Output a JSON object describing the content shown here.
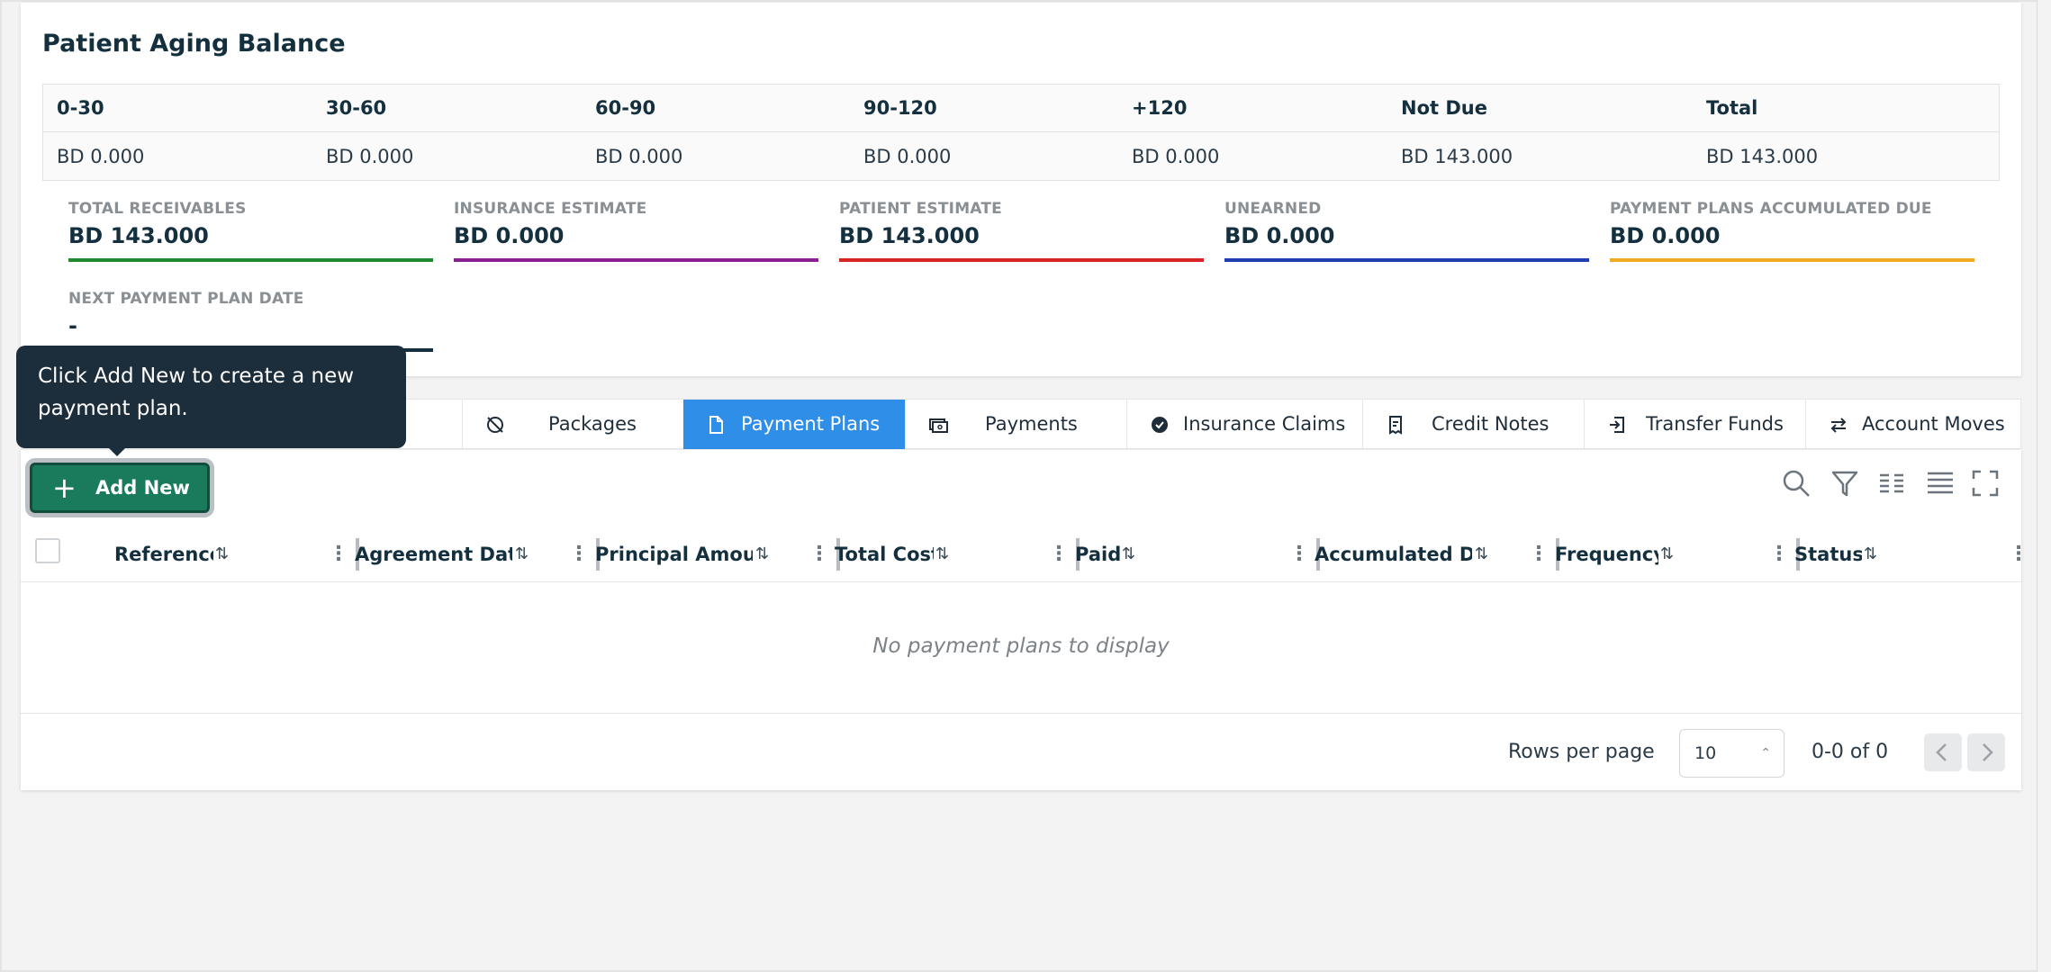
{
  "aging": {
    "title": "Patient Aging Balance",
    "headers": [
      "0-30",
      "30-60",
      "60-90",
      "90-120",
      "+120",
      "Not Due",
      "Total"
    ],
    "values": [
      "BD 0.000",
      "BD 0.000",
      "BD 0.000",
      "BD 0.000",
      "BD 0.000",
      "BD 143.000",
      "BD 143.000"
    ]
  },
  "metrics": [
    {
      "label": "TOTAL RECEIVABLES",
      "value": "BD 143.000",
      "color": "#1f8a2e"
    },
    {
      "label": "INSURANCE ESTIMATE",
      "value": "BD 0.000",
      "color": "#8a1f8f"
    },
    {
      "label": "PATIENT ESTIMATE",
      "value": "BD 143.000",
      "color": "#d92424"
    },
    {
      "label": "UNEARNED",
      "value": "BD 0.000",
      "color": "#1f3fb0"
    },
    {
      "label": "PAYMENT PLANS ACCUMULATED DUE",
      "value": "BD 0.000",
      "color": "#f0ac24"
    },
    {
      "label": "NEXT PAYMENT PLAN DATE",
      "value": "-",
      "color": "#14303f"
    }
  ],
  "tabs": [
    {
      "label": "Packages",
      "icon": "no-image-icon",
      "active": false
    },
    {
      "label": "Payment Plans",
      "icon": "document-icon",
      "active": true
    },
    {
      "label": "Payments",
      "icon": "cash-icon",
      "active": false
    },
    {
      "label": "Insurance Claims",
      "icon": "badge-icon",
      "active": false
    },
    {
      "label": "Credit Notes",
      "icon": "receipt-icon",
      "active": false
    },
    {
      "label": "Transfer Funds",
      "icon": "transfer-in-icon",
      "active": false
    },
    {
      "label": "Account Moves",
      "icon": "swap-icon",
      "active": false
    }
  ],
  "toolbar": {
    "add_label": "Add New",
    "icons": [
      "search-icon",
      "filter-icon",
      "columns-icon",
      "density-icon",
      "fullscreen-icon"
    ]
  },
  "table": {
    "columns": [
      "Reference",
      "Agreement Date",
      "Principal Amoun",
      "Total Cost",
      "Paid",
      "Accumulated Du",
      "Frequency",
      "Status"
    ],
    "empty_message": "No payment plans to display"
  },
  "pagination": {
    "rows_label": "Rows per page",
    "rows_value": "10",
    "range": "0-0 of 0"
  },
  "tooltip": {
    "text": "Click Add New to create a new payment plan."
  },
  "accent": "#2f8ee8",
  "primary_button": "#1a7a5c"
}
